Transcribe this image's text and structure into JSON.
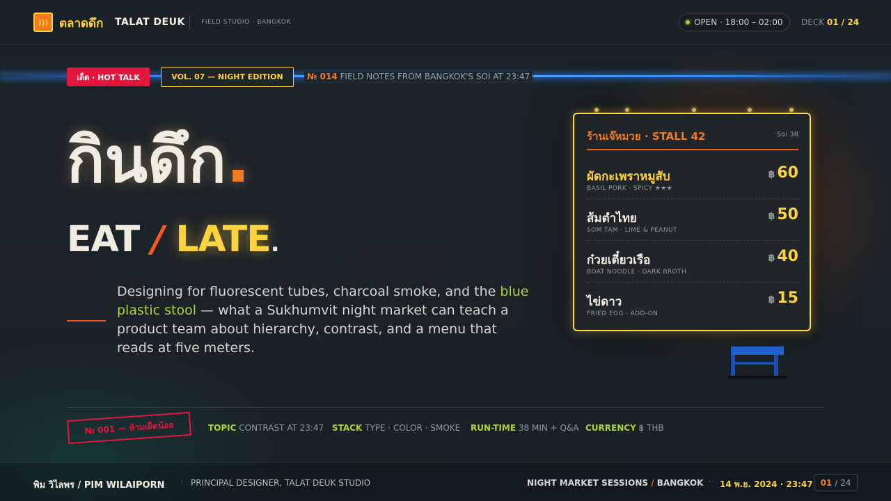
{
  "header": {
    "logo_glyph": ")))",
    "brand_thai": "ตลาดดึก",
    "brand_en": "TALAT DEUK",
    "brand_sub": "FIELD STUDIO · BANGKOK",
    "status": "OPEN · 18:00 – 02:00",
    "deck_label": "DECK",
    "deck_current": "01 / 24"
  },
  "tags": {
    "hot": "เด็ด · HOT TALK",
    "volume": "VOL. 07 — NIGHT EDITION",
    "notes_num": "№ 014",
    "notes_text": "FIELD NOTES FROM BANGKOK'S SOI AT 23:47"
  },
  "hero": {
    "thai": "กินดึก",
    "thai_dot": ".",
    "eat": "EAT",
    "slash": "/",
    "late": "LATE",
    "end_dot": "."
  },
  "lead": {
    "before": "Designing for fluorescent tubes, charcoal smoke, and the ",
    "emphasis": "blue plastic stool",
    "after": " — what a Sukhumvit night market can teach a product team about hierarchy, contrast, and a menu that reads at five meters."
  },
  "menu": {
    "title": "ร้านเจ๊หมวย · STALL 42",
    "soi": "Soi 38",
    "currency_symbol": "฿",
    "items": [
      {
        "name": "ผัดกะเพราหมูสับ",
        "sub": "BASIL PORK · SPICY ★★★",
        "price": "60"
      },
      {
        "name": "ส้มตำไทย",
        "sub": "SOM TAM · LIME & PEANUT",
        "price": "50"
      },
      {
        "name": "ก๋วยเตี๋ยวเรือ",
        "sub": "BOAT NOODLE · DARK BROTH",
        "price": "40"
      },
      {
        "name": "ไข่ดาว",
        "sub": "FRIED EGG · ADD-ON",
        "price": "15"
      }
    ]
  },
  "meta": {
    "stamp": "№ 001 — ห้ามเผ็ดน้อย",
    "topic_k": "TOPIC",
    "topic_v": "CONTRAST AT 23:47",
    "stack_k": "STACK",
    "stack_v": "TYPE · COLOR · SMOKE",
    "runtime_k": "RUN-TIME",
    "runtime_v": "38 MIN + Q&A",
    "currency_k": "CURRENCY",
    "currency_v": "฿ THB"
  },
  "footer": {
    "speaker": "พิม วิไลพร / PIM WILAIPORN",
    "sep": "·",
    "role": "PRINCIPAL DESIGNER, TALAT DEUK STUDIO",
    "sessions": "NIGHT MARKET SESSIONS",
    "slash": "/",
    "city": "BANGKOK",
    "date": "14 พ.ย. 2024 · 23:47",
    "page_current": "01",
    "page_total": "/ 24"
  },
  "colors": {
    "accent_yellow": "#ffd23f",
    "accent_orange": "#f47a20",
    "accent_red": "#e3163d",
    "accent_green": "#a8d63a",
    "neon_blue": "#2f8cff",
    "stool_blue": "#1f5fd0"
  }
}
